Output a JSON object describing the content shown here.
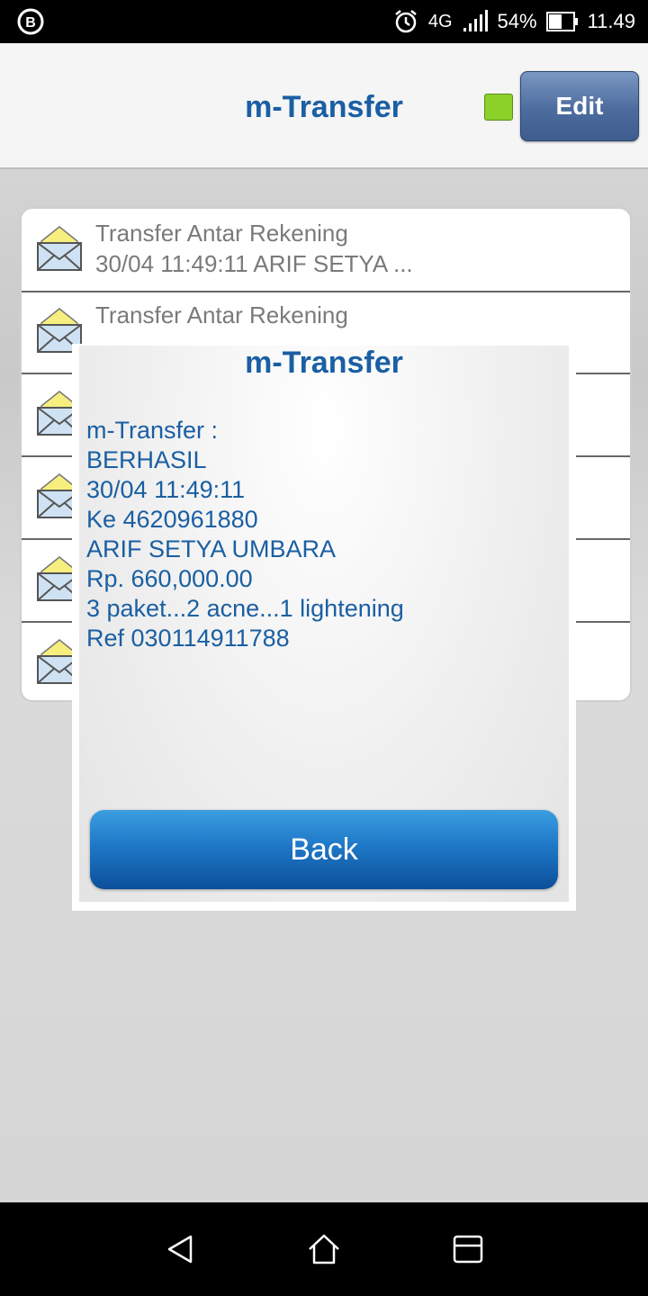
{
  "status_bar": {
    "network": "4G",
    "battery": "54%",
    "time": "11.49"
  },
  "header": {
    "title": "m-Transfer",
    "edit_label": "Edit",
    "status_color": "#8bd12a"
  },
  "list": {
    "items": [
      {
        "title": "Transfer Antar Rekening",
        "subtitle": "30/04 11:49:11 ARIF SETYA ..."
      },
      {
        "title": "Transfer Antar Rekening",
        "subtitle": ""
      },
      {
        "title": "",
        "subtitle": ""
      },
      {
        "title": "",
        "subtitle": ""
      },
      {
        "title": "",
        "subtitle": ""
      },
      {
        "title": "",
        "subtitle": ""
      }
    ]
  },
  "dialog": {
    "title": "m-Transfer",
    "lines": [
      "m-Transfer :",
      "BERHASIL",
      "30/04 11:49:11",
      "Ke 4620961880",
      "ARIF SETYA UMBARA",
      "Rp. 660,000.00",
      "3 paket...2 acne...1 lightening",
      "Ref 030114911788"
    ],
    "back_label": "Back"
  },
  "colors": {
    "accent": "#1a5fa3",
    "button_blue": "#1f78c7"
  },
  "icons": {
    "list_item": "envelope-icon",
    "nav": [
      "back-icon",
      "home-icon",
      "recents-icon"
    ]
  }
}
